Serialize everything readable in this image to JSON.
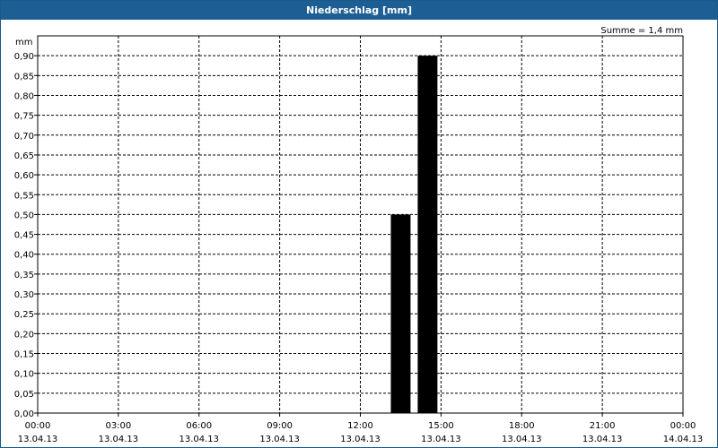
{
  "window": {
    "title": "Niederschlag [mm]"
  },
  "colors": {
    "titlebar": "#1d5f94",
    "bars": "#000000",
    "grid": "#000000"
  },
  "chart_data": {
    "type": "bar",
    "title": "Niederschlag [mm]",
    "ylabel": "mm",
    "annotation": "Summe = 1,4 mm",
    "ylim": [
      0,
      0.95
    ],
    "xlim_hours": [
      0,
      24
    ],
    "grid": true,
    "y_ticks": [
      "0,00",
      "0,05",
      "0,10",
      "0,15",
      "0,20",
      "0,25",
      "0,30",
      "0,35",
      "0,40",
      "0,45",
      "0,50",
      "0,55",
      "0,60",
      "0,65",
      "0,70",
      "0,75",
      "0,80",
      "0,85",
      "0,90"
    ],
    "x_ticks": [
      {
        "time": "00:00",
        "date": "13.04.13"
      },
      {
        "time": "03:00",
        "date": "13.04.13"
      },
      {
        "time": "06:00",
        "date": "13.04.13"
      },
      {
        "time": "09:00",
        "date": "13.04.13"
      },
      {
        "time": "12:00",
        "date": "13.04.13"
      },
      {
        "time": "15:00",
        "date": "13.04.13"
      },
      {
        "time": "18:00",
        "date": "13.04.13"
      },
      {
        "time": "21:00",
        "date": "13.04.13"
      },
      {
        "time": "00:00",
        "date": "14.04.13"
      }
    ],
    "bars": [
      {
        "start": "13.04.13 13:00",
        "end": "13.04.13 14:00",
        "value": 0.5
      },
      {
        "start": "13.04.13 14:00",
        "end": "13.04.13 15:00",
        "value": 0.9
      }
    ]
  }
}
